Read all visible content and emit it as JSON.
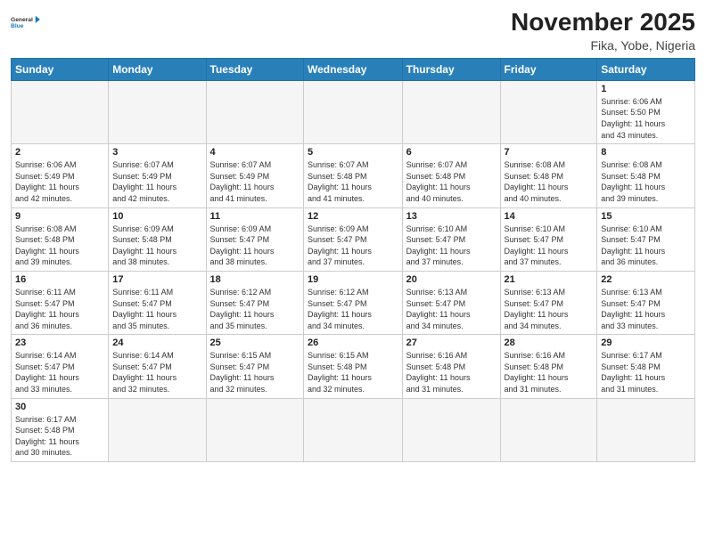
{
  "header": {
    "logo_general": "General",
    "logo_blue": "Blue",
    "month_title": "November 2025",
    "location": "Fika, Yobe, Nigeria"
  },
  "weekdays": [
    "Sunday",
    "Monday",
    "Tuesday",
    "Wednesday",
    "Thursday",
    "Friday",
    "Saturday"
  ],
  "cells": [
    {
      "day": "",
      "info": ""
    },
    {
      "day": "",
      "info": ""
    },
    {
      "day": "",
      "info": ""
    },
    {
      "day": "",
      "info": ""
    },
    {
      "day": "",
      "info": ""
    },
    {
      "day": "",
      "info": ""
    },
    {
      "day": "1",
      "info": "Sunrise: 6:06 AM\nSunset: 5:50 PM\nDaylight: 11 hours\nand 43 minutes."
    },
    {
      "day": "2",
      "info": "Sunrise: 6:06 AM\nSunset: 5:49 PM\nDaylight: 11 hours\nand 42 minutes."
    },
    {
      "day": "3",
      "info": "Sunrise: 6:07 AM\nSunset: 5:49 PM\nDaylight: 11 hours\nand 42 minutes."
    },
    {
      "day": "4",
      "info": "Sunrise: 6:07 AM\nSunset: 5:49 PM\nDaylight: 11 hours\nand 41 minutes."
    },
    {
      "day": "5",
      "info": "Sunrise: 6:07 AM\nSunset: 5:48 PM\nDaylight: 11 hours\nand 41 minutes."
    },
    {
      "day": "6",
      "info": "Sunrise: 6:07 AM\nSunset: 5:48 PM\nDaylight: 11 hours\nand 40 minutes."
    },
    {
      "day": "7",
      "info": "Sunrise: 6:08 AM\nSunset: 5:48 PM\nDaylight: 11 hours\nand 40 minutes."
    },
    {
      "day": "8",
      "info": "Sunrise: 6:08 AM\nSunset: 5:48 PM\nDaylight: 11 hours\nand 39 minutes."
    },
    {
      "day": "9",
      "info": "Sunrise: 6:08 AM\nSunset: 5:48 PM\nDaylight: 11 hours\nand 39 minutes."
    },
    {
      "day": "10",
      "info": "Sunrise: 6:09 AM\nSunset: 5:48 PM\nDaylight: 11 hours\nand 38 minutes."
    },
    {
      "day": "11",
      "info": "Sunrise: 6:09 AM\nSunset: 5:47 PM\nDaylight: 11 hours\nand 38 minutes."
    },
    {
      "day": "12",
      "info": "Sunrise: 6:09 AM\nSunset: 5:47 PM\nDaylight: 11 hours\nand 37 minutes."
    },
    {
      "day": "13",
      "info": "Sunrise: 6:10 AM\nSunset: 5:47 PM\nDaylight: 11 hours\nand 37 minutes."
    },
    {
      "day": "14",
      "info": "Sunrise: 6:10 AM\nSunset: 5:47 PM\nDaylight: 11 hours\nand 37 minutes."
    },
    {
      "day": "15",
      "info": "Sunrise: 6:10 AM\nSunset: 5:47 PM\nDaylight: 11 hours\nand 36 minutes."
    },
    {
      "day": "16",
      "info": "Sunrise: 6:11 AM\nSunset: 5:47 PM\nDaylight: 11 hours\nand 36 minutes."
    },
    {
      "day": "17",
      "info": "Sunrise: 6:11 AM\nSunset: 5:47 PM\nDaylight: 11 hours\nand 35 minutes."
    },
    {
      "day": "18",
      "info": "Sunrise: 6:12 AM\nSunset: 5:47 PM\nDaylight: 11 hours\nand 35 minutes."
    },
    {
      "day": "19",
      "info": "Sunrise: 6:12 AM\nSunset: 5:47 PM\nDaylight: 11 hours\nand 34 minutes."
    },
    {
      "day": "20",
      "info": "Sunrise: 6:13 AM\nSunset: 5:47 PM\nDaylight: 11 hours\nand 34 minutes."
    },
    {
      "day": "21",
      "info": "Sunrise: 6:13 AM\nSunset: 5:47 PM\nDaylight: 11 hours\nand 34 minutes."
    },
    {
      "day": "22",
      "info": "Sunrise: 6:13 AM\nSunset: 5:47 PM\nDaylight: 11 hours\nand 33 minutes."
    },
    {
      "day": "23",
      "info": "Sunrise: 6:14 AM\nSunset: 5:47 PM\nDaylight: 11 hours\nand 33 minutes."
    },
    {
      "day": "24",
      "info": "Sunrise: 6:14 AM\nSunset: 5:47 PM\nDaylight: 11 hours\nand 32 minutes."
    },
    {
      "day": "25",
      "info": "Sunrise: 6:15 AM\nSunset: 5:47 PM\nDaylight: 11 hours\nand 32 minutes."
    },
    {
      "day": "26",
      "info": "Sunrise: 6:15 AM\nSunset: 5:48 PM\nDaylight: 11 hours\nand 32 minutes."
    },
    {
      "day": "27",
      "info": "Sunrise: 6:16 AM\nSunset: 5:48 PM\nDaylight: 11 hours\nand 31 minutes."
    },
    {
      "day": "28",
      "info": "Sunrise: 6:16 AM\nSunset: 5:48 PM\nDaylight: 11 hours\nand 31 minutes."
    },
    {
      "day": "29",
      "info": "Sunrise: 6:17 AM\nSunset: 5:48 PM\nDaylight: 11 hours\nand 31 minutes."
    },
    {
      "day": "30",
      "info": "Sunrise: 6:17 AM\nSunset: 5:48 PM\nDaylight: 11 hours\nand 30 minutes."
    },
    {
      "day": "",
      "info": ""
    },
    {
      "day": "",
      "info": ""
    },
    {
      "day": "",
      "info": ""
    },
    {
      "day": "",
      "info": ""
    },
    {
      "day": "",
      "info": ""
    },
    {
      "day": "",
      "info": ""
    }
  ]
}
